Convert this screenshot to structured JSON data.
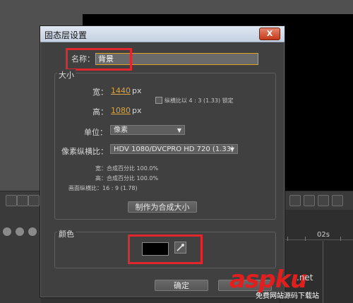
{
  "dialog": {
    "title": "固态层设置",
    "close_label": "X",
    "name_label": "名称：",
    "name_value": "背景",
    "size_group_title": "大小",
    "width_label": "宽：",
    "width_value": "1440",
    "width_unit": "px",
    "height_label": "高：",
    "height_value": "1080",
    "height_unit": "px",
    "lock_ratio_label": "纵横比以 4 : 3 (1.33) 锁定",
    "units_label": "单位：",
    "units_value": "像素",
    "pixel_aspect_label": "像素纵横比：",
    "pixel_aspect_value": "HDV 1080/DVCPRO HD 720 (1.33)",
    "info_width": "宽：合成百分比 100.0%",
    "info_height": "高：合成百分比 100.0%",
    "info_frame_aspect": "画面纵横比：16 : 9 (1.78)",
    "make_comp_size_label": "制作为合成大小",
    "color_group_title": "颜色",
    "color_value": "#000000",
    "ok_label": "确定"
  },
  "background": {
    "timeline_time_label": "02s"
  },
  "watermark": {
    "brand": "aspku",
    "domain_suffix": ".net",
    "subtitle": "免费网站源码下载站"
  },
  "colors": {
    "highlight_box": "#e1262d",
    "link_value": "#d9a441",
    "input_focus": "#e0a020"
  }
}
